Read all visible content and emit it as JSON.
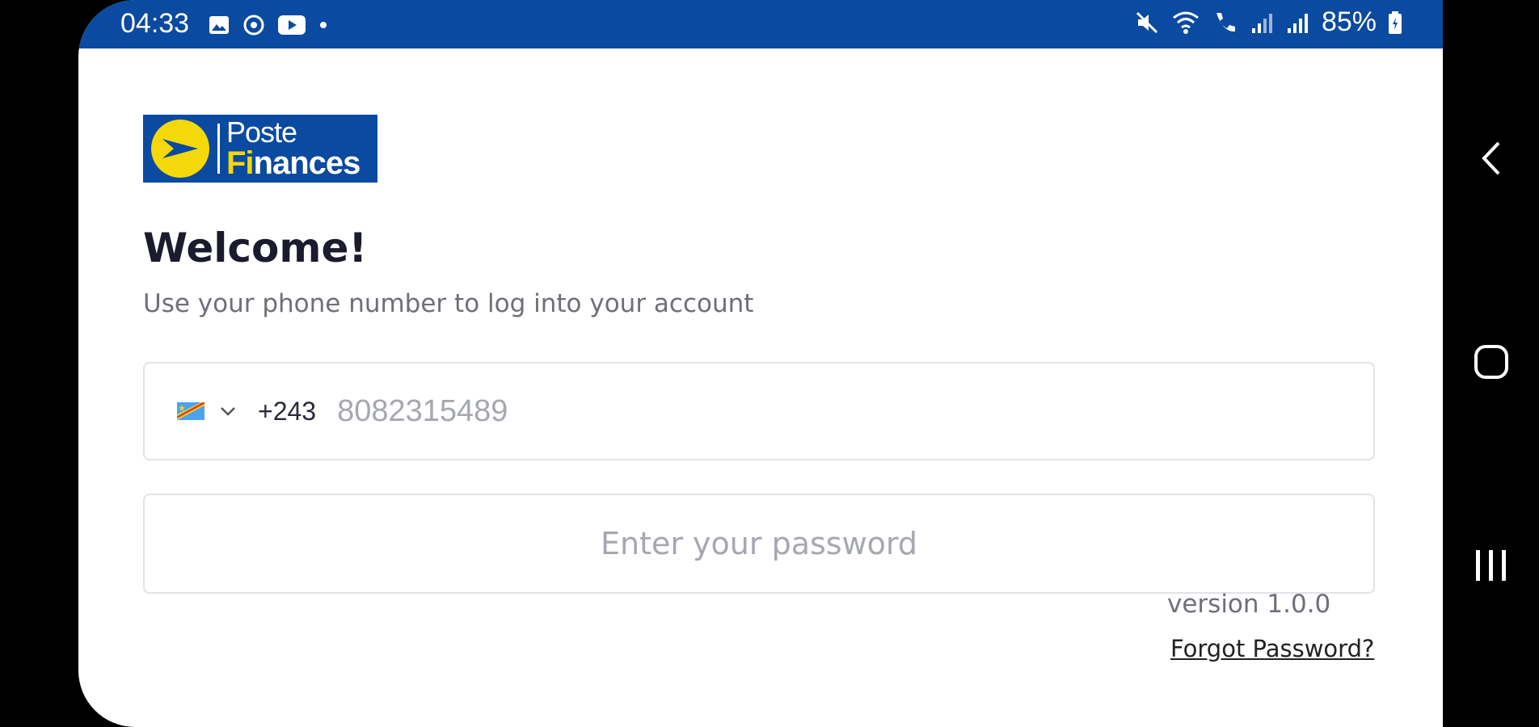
{
  "status_bar": {
    "time": "04:33",
    "battery": "85%",
    "icons_left": [
      "gallery-icon",
      "sync-icon",
      "youtube-icon",
      "dot-icon"
    ],
    "icons_right": [
      "mute-icon",
      "wifi-icon",
      "wifi-call-icon",
      "signal-icon",
      "signal-icon",
      "battery-icon"
    ]
  },
  "logo": {
    "line1": "Poste",
    "line2_accent": "Fi",
    "line2_rest": "nances"
  },
  "welcome": {
    "title": "Welcome!",
    "subtitle": "Use your phone number to log into your account"
  },
  "phone": {
    "country_code": "+243",
    "value": "8082315489",
    "flag_icon": "drc-flag-icon"
  },
  "password": {
    "placeholder": "Enter your password"
  },
  "version": "version 1.0.0",
  "forgot_password": "Forgot Password?",
  "colors": {
    "brand_blue": "#0a4aa0",
    "brand_yellow": "#f5d80a"
  }
}
